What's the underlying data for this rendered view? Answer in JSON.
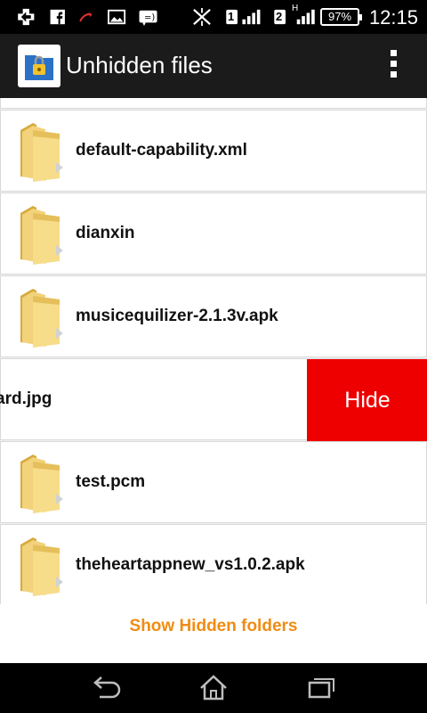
{
  "status_bar": {
    "time": "12:15",
    "battery": "97%",
    "sim1": "1",
    "sim2": "2",
    "network_type": "H"
  },
  "action_bar": {
    "title": "Unhidden files",
    "app_icon": "lock-folder-icon",
    "menu_icon": "overflow-menu-icon"
  },
  "files": [
    {
      "name": "default-capability.xml",
      "icon": "folder-icon"
    },
    {
      "name": "dianxin",
      "icon": "folder-icon"
    },
    {
      "name": "musicequilizer-2.1.3v.apk",
      "icon": "folder-icon"
    },
    {
      "name": "ard.jpg",
      "icon": "folder-icon",
      "swiped": true,
      "action_label": "Hide"
    },
    {
      "name": "test.pcm",
      "icon": "folder-icon"
    },
    {
      "name": "theheartappnew_vs1.0.2.apk",
      "icon": "folder-icon"
    }
  ],
  "footer": {
    "show_hidden_label": "Show Hidden folders"
  },
  "colors": {
    "action_bar": "#1b1b1b",
    "hide_button": "#ef0000",
    "link": "#f08c12"
  },
  "nav_bar": [
    "back-icon",
    "home-icon",
    "recent-apps-icon"
  ]
}
